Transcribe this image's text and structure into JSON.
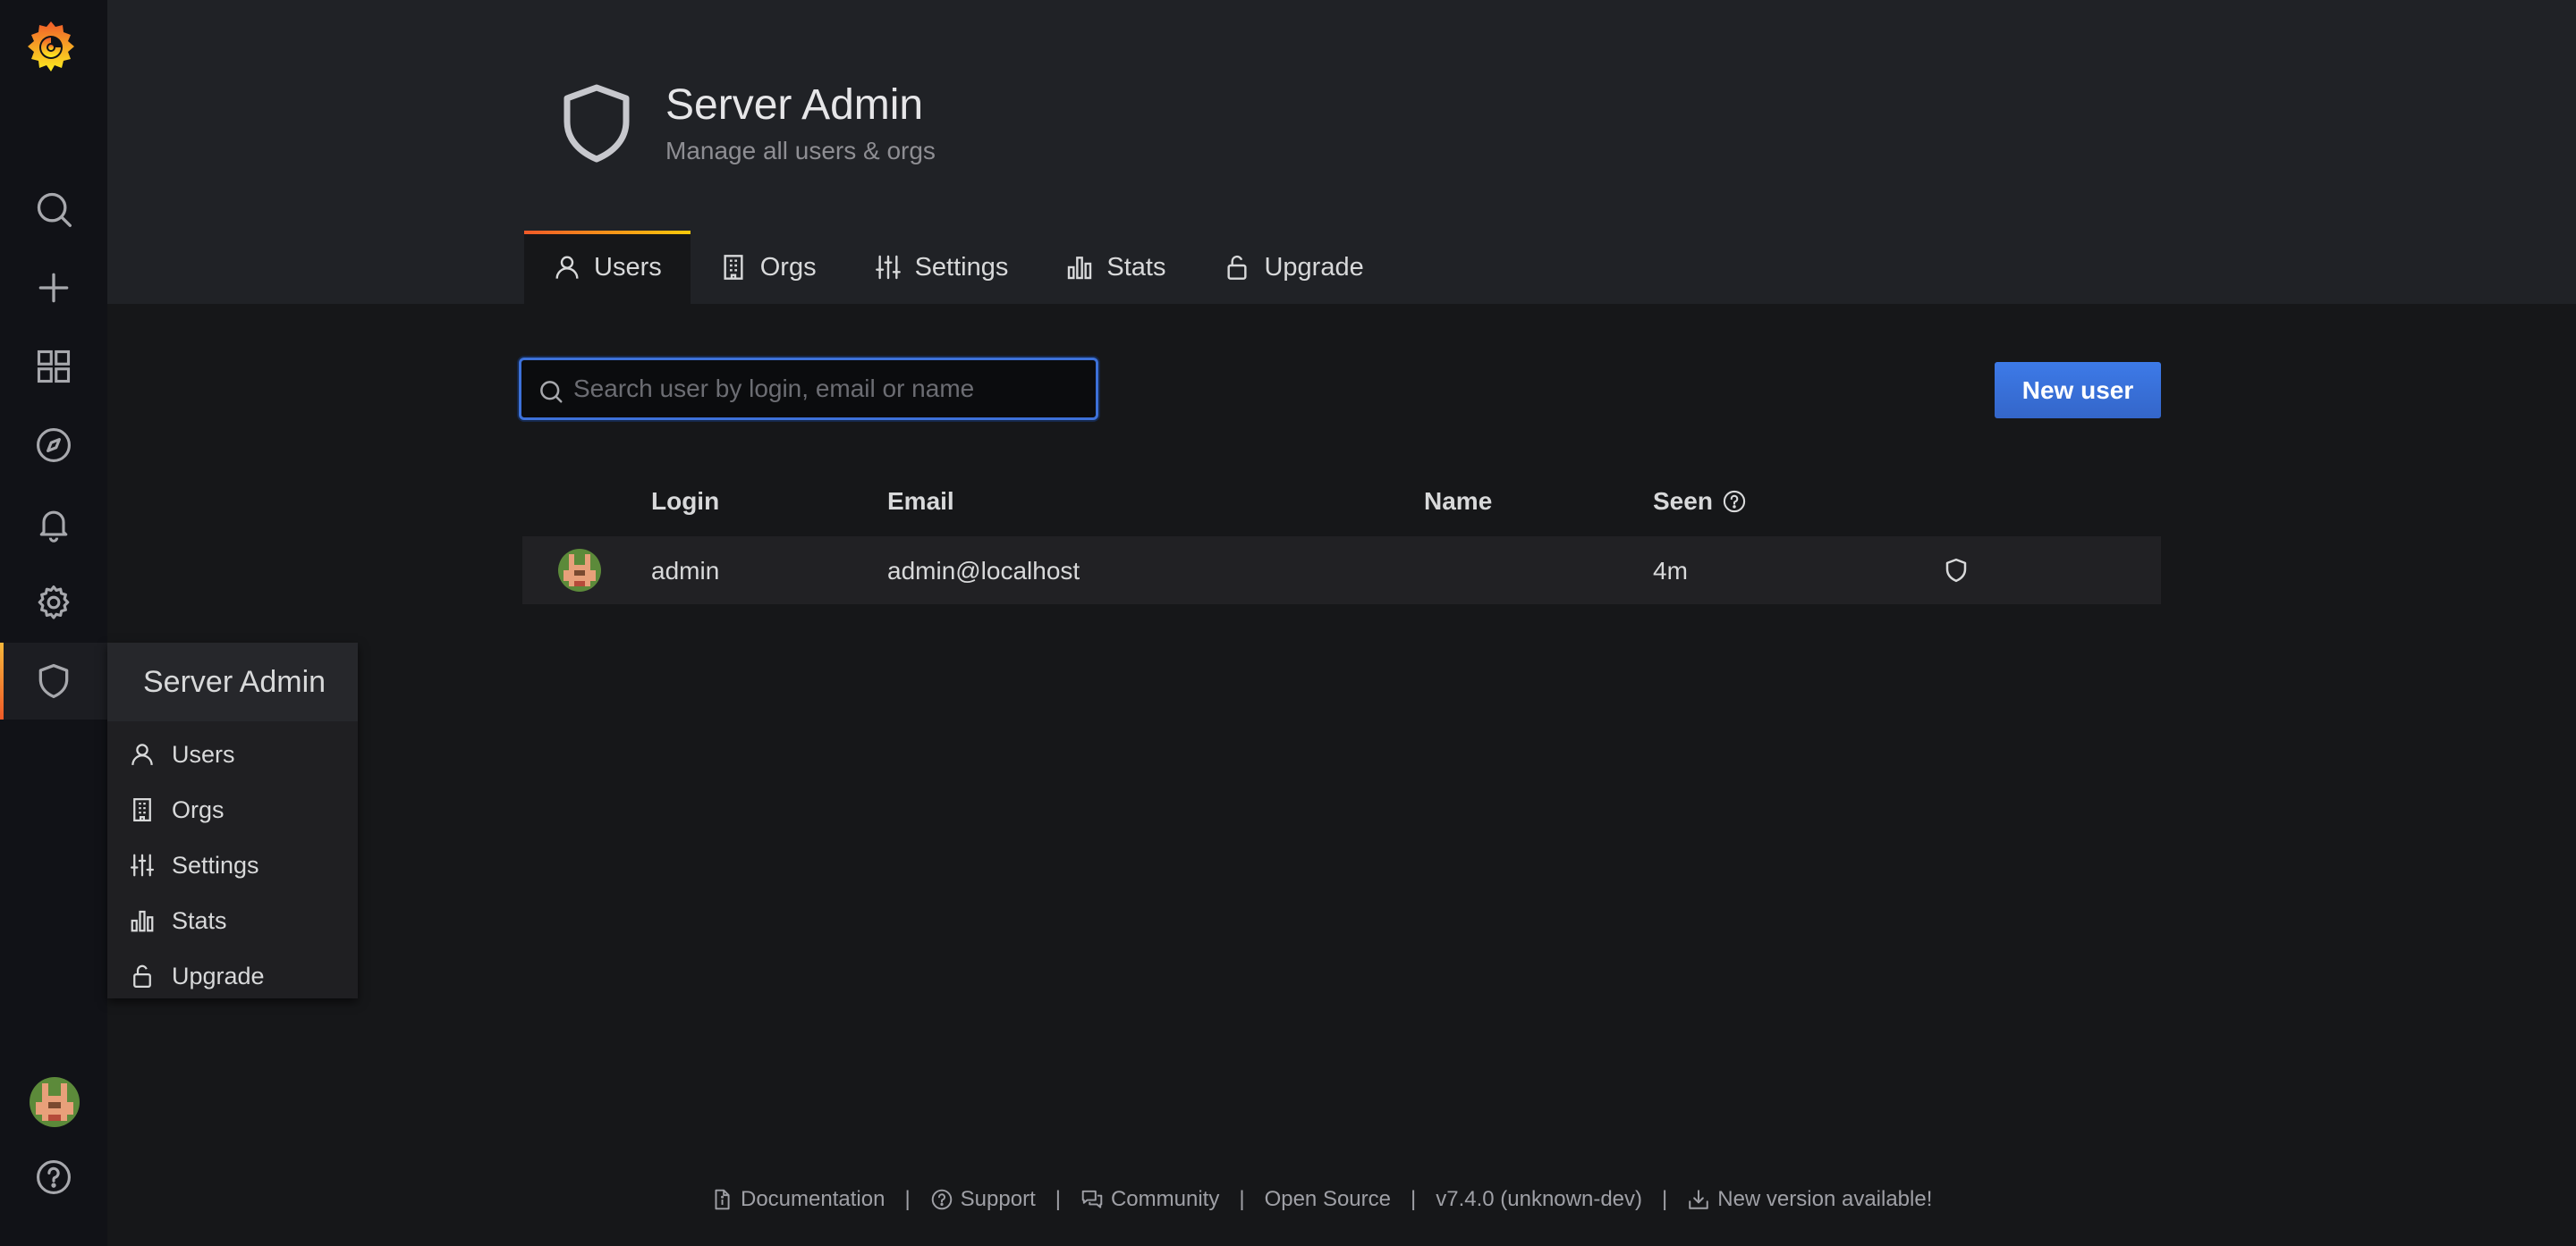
{
  "header": {
    "title": "Server Admin",
    "subtitle": "Manage all users & orgs"
  },
  "tabs": [
    {
      "label": "Users",
      "icon": "user-icon",
      "active": true
    },
    {
      "label": "Orgs",
      "icon": "building-icon",
      "active": false
    },
    {
      "label": "Settings",
      "icon": "sliders-icon",
      "active": false
    },
    {
      "label": "Stats",
      "icon": "bar-chart-icon",
      "active": false
    },
    {
      "label": "Upgrade",
      "icon": "unlock-icon",
      "active": false
    }
  ],
  "sidebar": {
    "items": [
      "search-icon",
      "plus-icon",
      "dashboards-icon",
      "explore-icon",
      "alerting-icon",
      "configuration-icon",
      "server-admin-icon"
    ],
    "active": "server-admin-icon",
    "bottom": [
      "avatar",
      "help-icon"
    ]
  },
  "flyout": {
    "title": "Server Admin",
    "items": [
      {
        "label": "Users",
        "icon": "user-icon"
      },
      {
        "label": "Orgs",
        "icon": "building-icon"
      },
      {
        "label": "Settings",
        "icon": "sliders-icon"
      },
      {
        "label": "Stats",
        "icon": "bar-chart-icon"
      },
      {
        "label": "Upgrade",
        "icon": "unlock-icon"
      }
    ]
  },
  "search": {
    "placeholder": "Search user by login, email or name",
    "value": ""
  },
  "new_user_button": "New user",
  "table": {
    "columns": {
      "login": "Login",
      "email": "Email",
      "name": "Name",
      "seen": "Seen"
    },
    "rows": [
      {
        "login": "admin",
        "email": "admin@localhost",
        "name": "",
        "seen": "4m",
        "is_admin": true
      }
    ]
  },
  "footer": {
    "documentation": "Documentation",
    "support": "Support",
    "community": "Community",
    "open_source": "Open Source",
    "version": "v7.4.0 (unknown-dev)",
    "new_version": "New version available!",
    "separator": "|"
  },
  "colors": {
    "accent_blue": "#3871dc",
    "active_gradient_start": "#f05a28",
    "active_gradient_end": "#fbca0a",
    "background": "#161719",
    "sidebar_bg": "#111217"
  }
}
